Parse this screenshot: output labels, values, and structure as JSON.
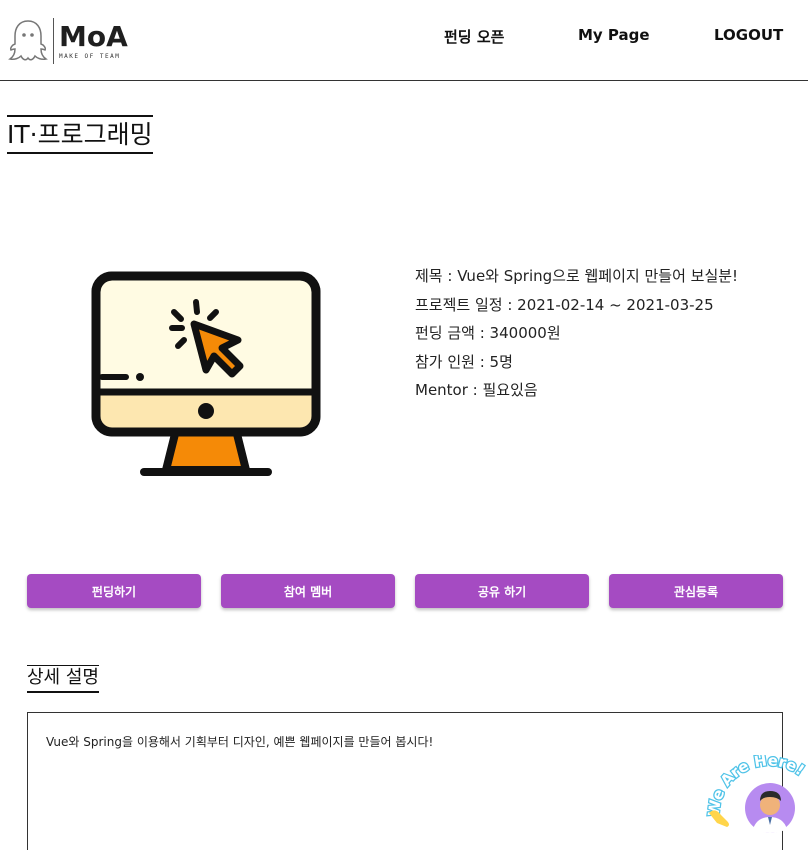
{
  "header": {
    "logo_word": "MoA",
    "logo_sub": "MAKE OF TEAM",
    "nav": {
      "open_funding": "펀딩 오픈",
      "my_page": "My Page",
      "logout": "LOGOUT"
    }
  },
  "category": "IT·프로그래밍",
  "project": {
    "image_icon": "monitor-cursor-icon",
    "title_line": "제목 : Vue와 Spring으로 웹페이지 만들어 보실분!",
    "schedule_line": "프로젝트 일정 : 2021-02-14 ~ 2021-03-25",
    "amount_line": "펀딩 금액 : 340000원",
    "participants_line": "참가 인원 : 5명",
    "mentor_line": "Mentor : 필요있음"
  },
  "actions": {
    "fund": "펀딩하기",
    "members": "참여 멤버",
    "share": "공유 하기",
    "interest": "관심등록"
  },
  "detail": {
    "title": "상세 설명",
    "text": "Vue와 Spring을 이용해서 기획부터 디자인, 예쁜 웹페이지를 만들어 봅시다!"
  },
  "chat_widget": {
    "label": "We Are Here!",
    "icon": "chat-avatar-icon"
  },
  "colors": {
    "button": "#a54bc2",
    "monitor_screen": "#fffbe3",
    "monitor_stand": "#f58a07",
    "cursor": "#f58a07"
  }
}
